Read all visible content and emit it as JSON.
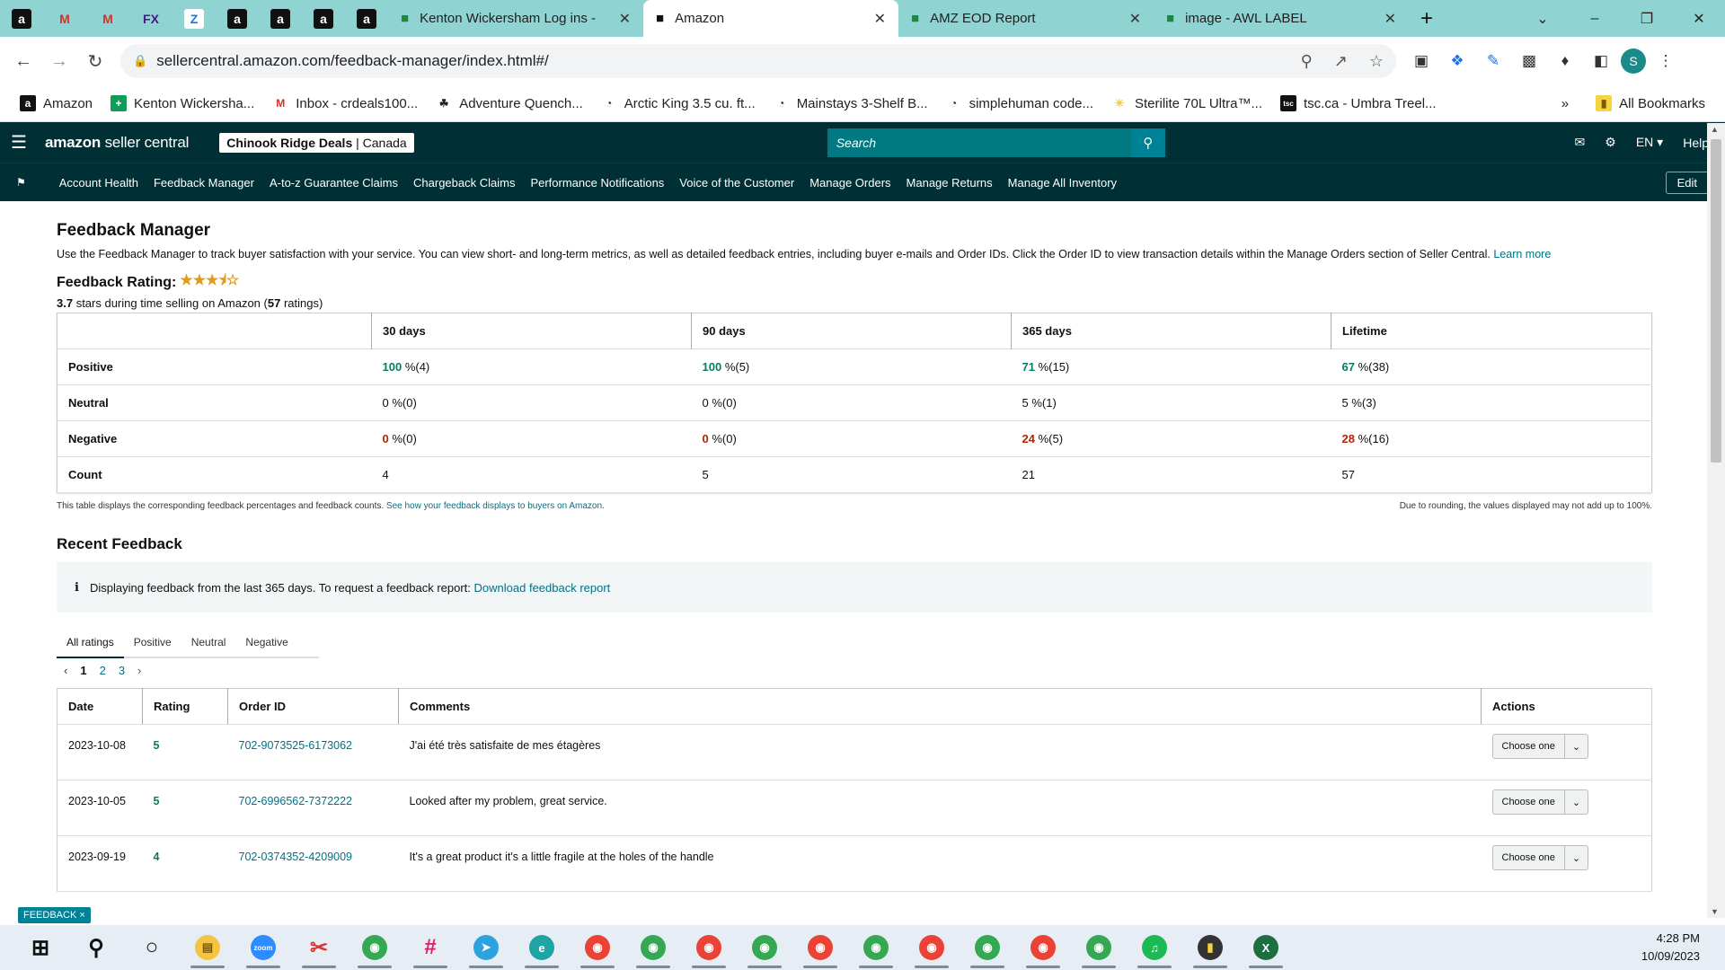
{
  "browser": {
    "pinned_tabs": [
      {
        "icon": "amazon-icon",
        "glyph": "a",
        "bg": "#111",
        "fg": "#fff"
      },
      {
        "icon": "gmail-icon",
        "glyph": "M",
        "bg": "transparent",
        "fg": "#d93025"
      },
      {
        "icon": "gmail-icon",
        "glyph": "M",
        "bg": "transparent",
        "fg": "#d93025"
      },
      {
        "icon": "fedex-icon",
        "glyph": "FX",
        "bg": "transparent",
        "fg": "#4d148c"
      },
      {
        "icon": "z-icon",
        "glyph": "Z",
        "bg": "#fff",
        "fg": "#1a73e8"
      },
      {
        "icon": "amazon-icon",
        "glyph": "a",
        "bg": "#111",
        "fg": "#fff"
      },
      {
        "icon": "amazon-icon",
        "glyph": "a",
        "bg": "#111",
        "fg": "#fff"
      },
      {
        "icon": "amazon-icon",
        "glyph": "a",
        "bg": "#111",
        "fg": "#fff"
      },
      {
        "icon": "amazon-icon",
        "glyph": "a",
        "bg": "#111",
        "fg": "#fff"
      }
    ],
    "tabs": [
      {
        "title": "Kenton Wickersham Log ins -",
        "icon": "sheets-icon",
        "active": false
      },
      {
        "title": "Amazon",
        "icon": "amazon-icon",
        "active": true
      },
      {
        "title": "AMZ EOD Report",
        "icon": "clickup-icon",
        "active": false
      },
      {
        "title": "image - AWL LABEL",
        "icon": "label-icon",
        "active": false
      }
    ],
    "url": "sellercentral.amazon.com/feedback-manager/index.html#/",
    "profile_initial": "S",
    "bookmarks": [
      {
        "label": "Amazon",
        "icon": "amazon-icon",
        "glyph": "a",
        "bg": "#111",
        "fg": "#fff"
      },
      {
        "label": "Kenton Wickersha...",
        "icon": "sheets-icon",
        "glyph": "+",
        "bg": "#0f9d58",
        "fg": "#fff"
      },
      {
        "label": "Inbox - crdeals100...",
        "icon": "gmail-icon",
        "glyph": "M",
        "bg": "transparent",
        "fg": "#d93025"
      },
      {
        "label": "Adventure Quench...",
        "icon": "moose-icon",
        "glyph": "☘",
        "bg": "transparent",
        "fg": "#222"
      },
      {
        "label": "Arctic King 3.5 cu. ft...",
        "icon": "globe-icon",
        "glyph": "◔",
        "bg": "transparent",
        "fg": "#222"
      },
      {
        "label": "Mainstays 3-Shelf B...",
        "icon": "globe-icon",
        "glyph": "◔",
        "bg": "transparent",
        "fg": "#222"
      },
      {
        "label": "simplehuman code...",
        "icon": "globe-icon",
        "glyph": "◔",
        "bg": "transparent",
        "fg": "#222"
      },
      {
        "label": "Sterilite 70L Ultra™...",
        "icon": "star-icon",
        "glyph": "✳",
        "bg": "transparent",
        "fg": "#e8c84a"
      },
      {
        "label": "tsc.ca - Umbra Treel...",
        "icon": "tsc-icon",
        "glyph": "tsc",
        "bg": "#111",
        "fg": "#fff"
      }
    ],
    "more_bookmarks": "»",
    "all_bookmarks": "All Bookmarks"
  },
  "header": {
    "logo_bold": "amazon",
    "logo_rest": " seller central",
    "store_name": "Chinook Ridge Deals",
    "store_region": " | Canada",
    "search_placeholder": "Search",
    "language": "EN ▾",
    "help": "Help"
  },
  "nav": {
    "items": [
      "Account Health",
      "Feedback Manager",
      "A-to-z Guarantee Claims",
      "Chargeback Claims",
      "Performance Notifications",
      "Voice of the Customer",
      "Manage Orders",
      "Manage Returns",
      "Manage All Inventory"
    ],
    "edit": "Edit"
  },
  "page": {
    "title": "Feedback Manager",
    "description": "Use the Feedback Manager to track buyer satisfaction with your service. You can view short- and long-term metrics, as well as detailed feedback entries, including buyer e-mails and Order IDs. Click the Order ID to view transaction details within the Manage Orders section of Seller Central.",
    "learn_more": "Learn more",
    "rating_label": "Feedback Rating:",
    "rating_stars": 3.5,
    "rating_value": "3.7",
    "rating_text_mid": " stars during time selling on Amazon (",
    "rating_count": "57",
    "rating_text_end": " ratings)"
  },
  "metrics": {
    "columns": [
      "30 days",
      "90 days",
      "365 days",
      "Lifetime"
    ],
    "rows": [
      {
        "label": "Positive",
        "cells": [
          {
            "pct": "100",
            "rest": " %(4)",
            "tone": "g"
          },
          {
            "pct": "100",
            "rest": " %(5)",
            "tone": "g"
          },
          {
            "pct": "71",
            "rest": " %(15)",
            "tone": "g"
          },
          {
            "pct": "67",
            "rest": " %(38)",
            "tone": "g"
          }
        ]
      },
      {
        "label": "Neutral",
        "cells": [
          {
            "pct": "0",
            "rest": " %(0)",
            "tone": ""
          },
          {
            "pct": "0",
            "rest": " %(0)",
            "tone": ""
          },
          {
            "pct": "5",
            "rest": " %(1)",
            "tone": ""
          },
          {
            "pct": "5",
            "rest": " %(3)",
            "tone": ""
          }
        ]
      },
      {
        "label": "Negative",
        "cells": [
          {
            "pct": "0",
            "rest": " %(0)",
            "tone": "r"
          },
          {
            "pct": "0",
            "rest": " %(0)",
            "tone": "r"
          },
          {
            "pct": "24",
            "rest": " %(5)",
            "tone": "r"
          },
          {
            "pct": "28",
            "rest": " %(16)",
            "tone": "r"
          }
        ]
      },
      {
        "label": "Count",
        "cells": [
          {
            "pct": "4",
            "rest": "",
            "tone": ""
          },
          {
            "pct": "5",
            "rest": "",
            "tone": ""
          },
          {
            "pct": "21",
            "rest": "",
            "tone": ""
          },
          {
            "pct": "57",
            "rest": "",
            "tone": ""
          }
        ]
      }
    ],
    "footnote": "This table displays the corresponding feedback percentages and feedback counts.",
    "footnote_link": "See how your feedback displays to buyers on Amazon.",
    "rounding_note": "Due to rounding, the values displayed may not add up to 100%."
  },
  "recent": {
    "title": "Recent Feedback",
    "info_text": "Displaying feedback from the last 365 days. To request a feedback report:",
    "info_link": "Download feedback report",
    "tabs": [
      "All ratings",
      "Positive",
      "Neutral",
      "Negative"
    ],
    "pages": [
      "1",
      "2",
      "3"
    ],
    "columns": [
      "Date",
      "Rating",
      "Order ID",
      "Comments",
      "Actions"
    ],
    "rows": [
      {
        "date": "2023-10-08",
        "rating": "5",
        "order_id": "702-9073525-6173062",
        "comment": "J'ai été très satisfaite de mes étagères",
        "action": "Choose one"
      },
      {
        "date": "2023-10-05",
        "rating": "5",
        "order_id": "702-6996562-7372222",
        "comment": "Looked after my problem, great service.",
        "action": "Choose one"
      },
      {
        "date": "2023-09-19",
        "rating": "4",
        "order_id": "702-0374352-4209009",
        "comment": "It's a great product it's a little fragile at the holes of the handle",
        "action": "Choose one"
      }
    ]
  },
  "feedback_tag": "FEEDBACK ×",
  "taskbar": {
    "apps": [
      {
        "icon": "windows-start-icon",
        "glyph": "⊞",
        "bg": "transparent",
        "fg": "#111"
      },
      {
        "icon": "search-icon",
        "glyph": "⚲",
        "bg": "transparent",
        "fg": "#111"
      },
      {
        "icon": "task-view-icon",
        "glyph": "○",
        "bg": "transparent",
        "fg": "#111"
      },
      {
        "icon": "file-explorer-icon",
        "glyph": "▤",
        "bg": "#f5c542",
        "fg": "#7a5a00"
      },
      {
        "icon": "zoom-icon",
        "glyph": "zoom",
        "bg": "#2d8cff",
        "fg": "#fff"
      },
      {
        "icon": "snip-icon",
        "glyph": "✂",
        "bg": "transparent",
        "fg": "#d33"
      },
      {
        "icon": "chrome-icon",
        "glyph": "◉",
        "bg": "#34a853",
        "fg": "#fff"
      },
      {
        "icon": "slack-icon",
        "glyph": "#",
        "bg": "transparent",
        "fg": "#e01e5a"
      },
      {
        "icon": "telegram-icon",
        "glyph": "➤",
        "bg": "#2aa3df",
        "fg": "#fff"
      },
      {
        "icon": "edge-icon",
        "glyph": "e",
        "bg": "#1fa3a3",
        "fg": "#fff"
      },
      {
        "icon": "chrome-icon",
        "glyph": "◉",
        "bg": "#ea4335",
        "fg": "#fff"
      },
      {
        "icon": "chrome-icon",
        "glyph": "◉",
        "bg": "#34a853",
        "fg": "#fff"
      },
      {
        "icon": "chrome-icon",
        "glyph": "◉",
        "bg": "#ea4335",
        "fg": "#fff"
      },
      {
        "icon": "chrome-icon",
        "glyph": "◉",
        "bg": "#34a853",
        "fg": "#fff"
      },
      {
        "icon": "chrome-icon",
        "glyph": "◉",
        "bg": "#ea4335",
        "fg": "#fff"
      },
      {
        "icon": "chrome-icon",
        "glyph": "◉",
        "bg": "#34a853",
        "fg": "#fff"
      },
      {
        "icon": "chrome-icon",
        "glyph": "◉",
        "bg": "#ea4335",
        "fg": "#fff"
      },
      {
        "icon": "chrome-icon",
        "glyph": "◉",
        "bg": "#34a853",
        "fg": "#fff"
      },
      {
        "icon": "chrome-icon",
        "glyph": "◉",
        "bg": "#ea4335",
        "fg": "#fff"
      },
      {
        "icon": "chrome-icon",
        "glyph": "◉",
        "bg": "#34a853",
        "fg": "#fff"
      },
      {
        "icon": "spotify-icon",
        "glyph": "♫",
        "bg": "#1db954",
        "fg": "#fff"
      },
      {
        "icon": "sticky-notes-icon",
        "glyph": "▮",
        "bg": "#333",
        "fg": "#f5d442"
      },
      {
        "icon": "excel-icon",
        "glyph": "X",
        "bg": "#1d6f42",
        "fg": "#fff"
      }
    ],
    "time": "4:28 PM",
    "date": "10/09/2023"
  },
  "colors": {
    "header_bg": "#002f36",
    "link": "#007185",
    "positive": "#067d62",
    "negative": "#b12704",
    "tab_strip": "#8fd3d3"
  }
}
